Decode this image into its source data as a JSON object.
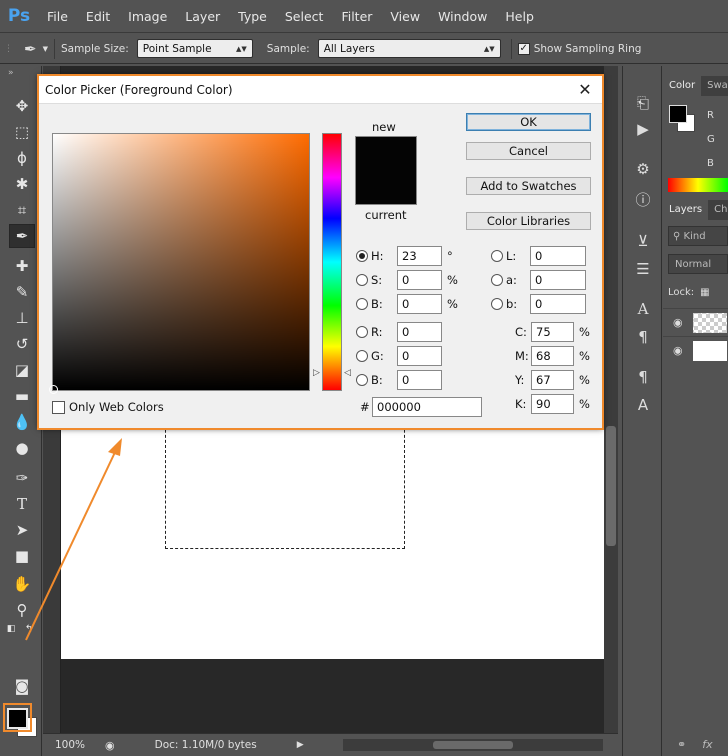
{
  "app": {
    "logo": "Ps"
  },
  "menu": [
    "File",
    "Edit",
    "Image",
    "Layer",
    "Type",
    "Select",
    "Filter",
    "View",
    "Window",
    "Help"
  ],
  "options": {
    "sample_size_label": "Sample Size:",
    "sample_size_value": "Point Sample",
    "sample_label": "Sample:",
    "sample_value": "All Layers",
    "show_ring_label": "Show Sampling Ring"
  },
  "status": {
    "zoom": "100%",
    "doc": "Doc: 1.10M/0 bytes"
  },
  "panels": {
    "color_tabs": [
      "Color",
      "Swa"
    ],
    "layer_tabs": [
      "Layers",
      "Cha"
    ],
    "kind_label": "Kind",
    "blend_mode": "Normal",
    "lock_label": "Lock:",
    "rgb_labels": [
      "R",
      "G",
      "B"
    ]
  },
  "dialog": {
    "title": "Color Picker (Foreground Color)",
    "close": "✕",
    "new_label": "new",
    "current_label": "current",
    "new_color": "#040404",
    "current_color": "#040404",
    "hue_base": "#ff6b00",
    "buttons": {
      "ok": "OK",
      "cancel": "Cancel",
      "add_swatches": "Add to Swatches",
      "color_libraries": "Color Libraries"
    },
    "hsb": {
      "h": {
        "label": "H:",
        "value": "23",
        "unit": "°"
      },
      "s": {
        "label": "S:",
        "value": "0",
        "unit": "%"
      },
      "b": {
        "label": "B:",
        "value": "0",
        "unit": "%"
      }
    },
    "rgb": {
      "r": {
        "label": "R:",
        "value": "0"
      },
      "g": {
        "label": "G:",
        "value": "0"
      },
      "b": {
        "label": "B:",
        "value": "0"
      }
    },
    "lab": {
      "l": {
        "label": "L:",
        "value": "0"
      },
      "a": {
        "label": "a:",
        "value": "0"
      },
      "b": {
        "label": "b:",
        "value": "0"
      }
    },
    "cmyk": {
      "c": {
        "label": "C:",
        "value": "75",
        "unit": "%"
      },
      "m": {
        "label": "M:",
        "value": "68",
        "unit": "%"
      },
      "y": {
        "label": "Y:",
        "value": "67",
        "unit": "%"
      },
      "k": {
        "label": "K:",
        "value": "90",
        "unit": "%"
      }
    },
    "web_colors_label": "Only Web Colors",
    "hex_prefix": "#",
    "hex_value": "000000"
  },
  "colors": {
    "accent_highlight": "#f08a2c",
    "foreground": "#000000",
    "background": "#ffffff"
  }
}
